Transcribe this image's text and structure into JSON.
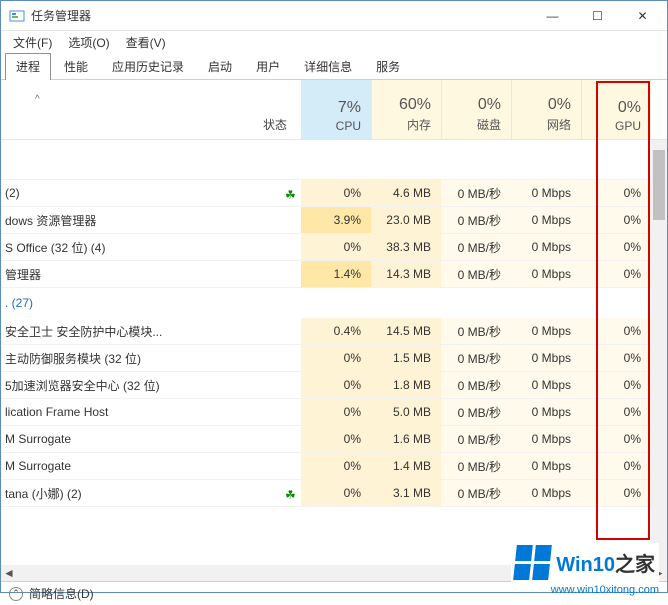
{
  "window": {
    "title": "任务管理器",
    "min": "—",
    "max": "☐",
    "close": "✕"
  },
  "menu": {
    "file": "文件(F)",
    "options": "选项(O)",
    "view": "查看(V)"
  },
  "tabs": [
    {
      "label": "进程",
      "active": true
    },
    {
      "label": "性能",
      "active": false
    },
    {
      "label": "应用历史记录",
      "active": false
    },
    {
      "label": "启动",
      "active": false
    },
    {
      "label": "用户",
      "active": false
    },
    {
      "label": "详细信息",
      "active": false
    },
    {
      "label": "服务",
      "active": false
    }
  ],
  "columns": {
    "sort": "^",
    "status": "状态",
    "cpu": {
      "pct": "7%",
      "lbl": "CPU"
    },
    "mem": {
      "pct": "60%",
      "lbl": "内存"
    },
    "disk": {
      "pct": "0%",
      "lbl": "磁盘"
    },
    "net": {
      "pct": "0%",
      "lbl": "网络"
    },
    "gpu": {
      "pct": "0%",
      "lbl": "GPU"
    }
  },
  "processes": [
    {
      "name": "(2)",
      "cpu": "0%",
      "mem": "4.6 MB",
      "disk": "0 MB/秒",
      "net": "0 Mbps",
      "gpu": "0%",
      "leaf": true
    },
    {
      "name": "dows 资源管理器",
      "cpu": "3.9%",
      "mem": "23.0 MB",
      "disk": "0 MB/秒",
      "net": "0 Mbps",
      "gpu": "0%",
      "cpuhi": true
    },
    {
      "name": "S Office (32 位) (4)",
      "cpu": "0%",
      "mem": "38.3 MB",
      "disk": "0 MB/秒",
      "net": "0 Mbps",
      "gpu": "0%"
    },
    {
      "name": "管理器",
      "cpu": "1.4%",
      "mem": "14.3 MB",
      "disk": "0 MB/秒",
      "net": "0 Mbps",
      "gpu": "0%",
      "cpuhi": true
    }
  ],
  "group": ". (27)",
  "processes2": [
    {
      "name": "安全卫士 安全防护中心模块...",
      "cpu": "0.4%",
      "mem": "14.5 MB",
      "disk": "0 MB/秒",
      "net": "0 Mbps",
      "gpu": "0%"
    },
    {
      "name": "主动防御服务模块 (32 位)",
      "cpu": "0%",
      "mem": "1.5 MB",
      "disk": "0 MB/秒",
      "net": "0 Mbps",
      "gpu": "0%"
    },
    {
      "name": "5加速浏览器安全中心 (32 位)",
      "cpu": "0%",
      "mem": "1.8 MB",
      "disk": "0 MB/秒",
      "net": "0 Mbps",
      "gpu": "0%"
    },
    {
      "name": "lication Frame Host",
      "cpu": "0%",
      "mem": "5.0 MB",
      "disk": "0 MB/秒",
      "net": "0 Mbps",
      "gpu": "0%"
    },
    {
      "name": "M Surrogate",
      "cpu": "0%",
      "mem": "1.6 MB",
      "disk": "0 MB/秒",
      "net": "0 Mbps",
      "gpu": "0%"
    },
    {
      "name": "M Surrogate",
      "cpu": "0%",
      "mem": "1.4 MB",
      "disk": "0 MB/秒",
      "net": "0 Mbps",
      "gpu": "0%"
    },
    {
      "name": "tana (小娜) (2)",
      "cpu": "0%",
      "mem": "3.1 MB",
      "disk": "0 MB/秒",
      "net": "0 Mbps",
      "gpu": "0%",
      "leaf": true
    }
  ],
  "statusbar": {
    "fewer": "简略信息(D)"
  },
  "watermark": {
    "brand1": "Win10",
    "brand2": "之家",
    "url": "www.win10xitong.com"
  }
}
